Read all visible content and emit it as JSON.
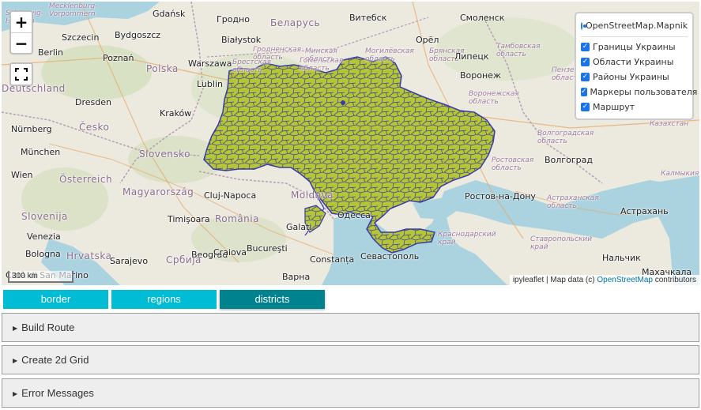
{
  "map": {
    "zoom_in": "+",
    "zoom_out": "−",
    "scale": "300 km",
    "labels": [
      {
        "text": "Gdańsk",
        "kind": "city"
      },
      {
        "text": "Гродно",
        "kind": "city"
      },
      {
        "text": "Беларусь",
        "kind": "country"
      },
      {
        "text": "Витебск",
        "kind": "city"
      },
      {
        "text": "Смоленск",
        "kind": "city"
      },
      {
        "text": "Szczecin",
        "kind": "city"
      },
      {
        "text": "Bydgoszcz",
        "kind": "city"
      },
      {
        "text": "Białystok",
        "kind": "city"
      },
      {
        "text": "Гродненская\nобласть",
        "kind": "region"
      },
      {
        "text": "Минская\nобласть",
        "kind": "region"
      },
      {
        "text": "Могилёвская\nобласть",
        "kind": "region"
      },
      {
        "text": "Брянская\nобласть",
        "kind": "region"
      },
      {
        "text": "Орёл",
        "kind": "city"
      },
      {
        "text": "Тамбовская\nобласть",
        "kind": "region"
      },
      {
        "text": "Berlin",
        "kind": "city"
      },
      {
        "text": "Poznań",
        "kind": "city"
      },
      {
        "text": "Warszawa",
        "kind": "city"
      },
      {
        "text": "Брестская\nобласть",
        "kind": "region"
      },
      {
        "text": "Гомельская\nобласть",
        "kind": "region"
      },
      {
        "text": "Липецк",
        "kind": "city"
      },
      {
        "text": "Пензенская\nобласть",
        "kind": "region"
      },
      {
        "text": "Polska",
        "kind": "country"
      },
      {
        "text": "Lublin",
        "kind": "city"
      },
      {
        "text": "Воронеж",
        "kind": "city"
      },
      {
        "text": "Воронежская\nобласть",
        "kind": "region"
      },
      {
        "text": "Dresden",
        "kind": "city"
      },
      {
        "text": "Kraków",
        "kind": "city"
      },
      {
        "text": "Nürnberg",
        "kind": "city"
      },
      {
        "text": "Česko",
        "kind": "country"
      },
      {
        "text": "Волгоградская\nобласть",
        "kind": "region"
      },
      {
        "text": "Казахстан",
        "kind": "region"
      },
      {
        "text": "Slovensko",
        "kind": "country"
      },
      {
        "text": "Ростовская\nобласть",
        "kind": "region"
      },
      {
        "text": "Волгоград",
        "kind": "city"
      },
      {
        "text": "München",
        "kind": "city"
      },
      {
        "text": "Wien",
        "kind": "city"
      },
      {
        "text": "Österreich",
        "kind": "country"
      },
      {
        "text": "Magyarország",
        "kind": "country"
      },
      {
        "text": "Cluj-Napoca",
        "kind": "city"
      },
      {
        "text": "Moldova",
        "kind": "country"
      },
      {
        "text": "Ростов-на-Дону",
        "kind": "city"
      },
      {
        "text": "Астраханская\nобласть",
        "kind": "region"
      },
      {
        "text": "Калмыкия",
        "kind": "region"
      },
      {
        "text": "Slovenija",
        "kind": "country"
      },
      {
        "text": "Timişoara",
        "kind": "city"
      },
      {
        "text": "România",
        "kind": "country"
      },
      {
        "text": "Одесса",
        "kind": "city"
      },
      {
        "text": "Астрахань",
        "kind": "city"
      },
      {
        "text": "Venezia",
        "kind": "city"
      },
      {
        "text": "Galați",
        "kind": "city"
      },
      {
        "text": "Краснодарский\nкрай",
        "kind": "region"
      },
      {
        "text": "Bologna",
        "kind": "city"
      },
      {
        "text": "Hrvatska",
        "kind": "country"
      },
      {
        "text": "Beograd",
        "kind": "city"
      },
      {
        "text": "Bucureşti",
        "kind": "city"
      },
      {
        "text": "Севастополь",
        "kind": "city"
      },
      {
        "text": "Ставропольский\nкрай",
        "kind": "region"
      },
      {
        "text": "Sarajevo",
        "kind": "city"
      },
      {
        "text": "Србија",
        "kind": "country"
      },
      {
        "text": "Craiova",
        "kind": "city"
      },
      {
        "text": "Constanța",
        "kind": "city"
      },
      {
        "text": "Нальчик",
        "kind": "city"
      },
      {
        "text": "Варна",
        "kind": "city"
      },
      {
        "text": "Махачкала",
        "kind": "city"
      },
      {
        "text": "Città di San\nMarino",
        "kind": "city"
      },
      {
        "text": "Mecklenburg-\nVorpommern",
        "kind": "region"
      },
      {
        "text": "Schleswig-\nHolstein",
        "kind": "region"
      },
      {
        "text": "Deutschland",
        "kind": "country"
      }
    ],
    "attribution": {
      "prefix": "ipyleaflet | Map data (c) ",
      "link": "OpenStreetMap",
      "suffix": " contributors"
    },
    "colors": {
      "polygon_fill": "#b5c634",
      "polygon_stroke": "#3a3aa8",
      "land": "#e8e4d8",
      "sea": "#aad3df",
      "forest": "#c8d9b0"
    }
  },
  "layers": {
    "base": "OpenStreetMap.Mapnik",
    "overlays": [
      "Границы Украины",
      "Области Украины",
      "Районы Украины",
      "Маркеры пользователя",
      "Маршрут"
    ]
  },
  "tabs": [
    "border",
    "regions",
    "districts"
  ],
  "active_tab": "districts",
  "sections": [
    "Build Route",
    "Create 2d Grid",
    "Error Messages"
  ]
}
